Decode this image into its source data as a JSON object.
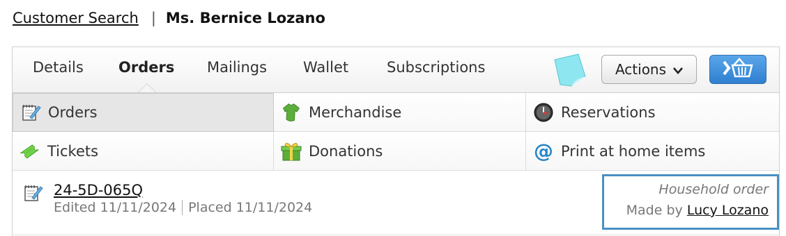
{
  "breadcrumb": {
    "search_link": "Customer Search",
    "separator": "|",
    "customer_name": "Ms. Bernice Lozano"
  },
  "tabs": [
    {
      "label": "Details",
      "active": false
    },
    {
      "label": "Orders",
      "active": true
    },
    {
      "label": "Mailings",
      "active": false
    },
    {
      "label": "Wallet",
      "active": false
    },
    {
      "label": "Subscriptions",
      "active": false
    }
  ],
  "toolbar": {
    "actions_label": "Actions",
    "note_icon": "sticky-note-icon",
    "basket_icon": "basket-icon"
  },
  "categories": [
    {
      "label": "Orders",
      "icon": "notepad-pencil-icon",
      "selected": true
    },
    {
      "label": "Merchandise",
      "icon": "tshirt-icon",
      "selected": false
    },
    {
      "label": "Reservations",
      "icon": "clock-icon",
      "selected": false
    },
    {
      "label": "Tickets",
      "icon": "ticket-icon",
      "selected": false
    },
    {
      "label": "Donations",
      "icon": "gift-icon",
      "selected": false
    },
    {
      "label": "Print at home items",
      "icon": "at-sign-icon",
      "selected": false
    }
  ],
  "order": {
    "number": "24-5D-065Q",
    "edited": "Edited 11/11/2024",
    "placed": "Placed 11/11/2024",
    "household_label": "Household order",
    "made_by_prefix": "Made by",
    "made_by_name": "Lucy Lozano"
  },
  "colors": {
    "accent_blue": "#2f7fd0",
    "highlight_border": "#4a90c2",
    "note_cyan": "#8ee6f0"
  }
}
